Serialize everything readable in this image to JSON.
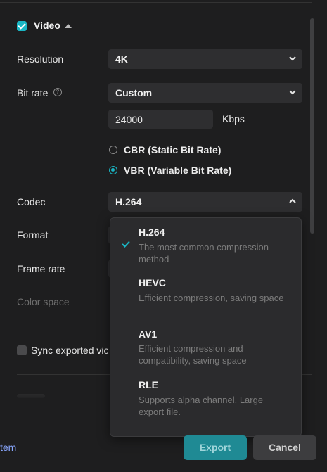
{
  "video": {
    "title": "Video",
    "enabled": true
  },
  "resolution": {
    "label": "Resolution",
    "value": "4K"
  },
  "bitrate": {
    "label": "Bit rate",
    "mode": "Custom",
    "value": "24000",
    "unit": "Kbps",
    "options": [
      {
        "label": "CBR (Static Bit Rate)",
        "selected": false
      },
      {
        "label": "VBR (Variable Bit Rate)",
        "selected": true
      }
    ]
  },
  "codec": {
    "label": "Codec",
    "value": "H.264",
    "options": [
      {
        "title": "H.264",
        "desc": "The most common compression method",
        "selected": true
      },
      {
        "title": "HEVC",
        "desc": "Efficient compression, saving space",
        "selected": false
      },
      {
        "title": "AV1",
        "desc": "Efficient compression and compatibility, saving space",
        "selected": false
      },
      {
        "title": "RLE",
        "desc": "Supports alpha channel. Large export file.",
        "selected": false
      }
    ]
  },
  "format": {
    "label": "Format"
  },
  "framerate": {
    "label": "Frame rate"
  },
  "colorspace": {
    "label": "Color space"
  },
  "sync": {
    "label": "Sync exported vic"
  },
  "footer": {
    "link": "tem",
    "export": "Export",
    "cancel": "Cancel"
  },
  "colors": {
    "accent": "#1ab6c4",
    "background": "#1e1e1f",
    "control": "#2e2e30"
  }
}
